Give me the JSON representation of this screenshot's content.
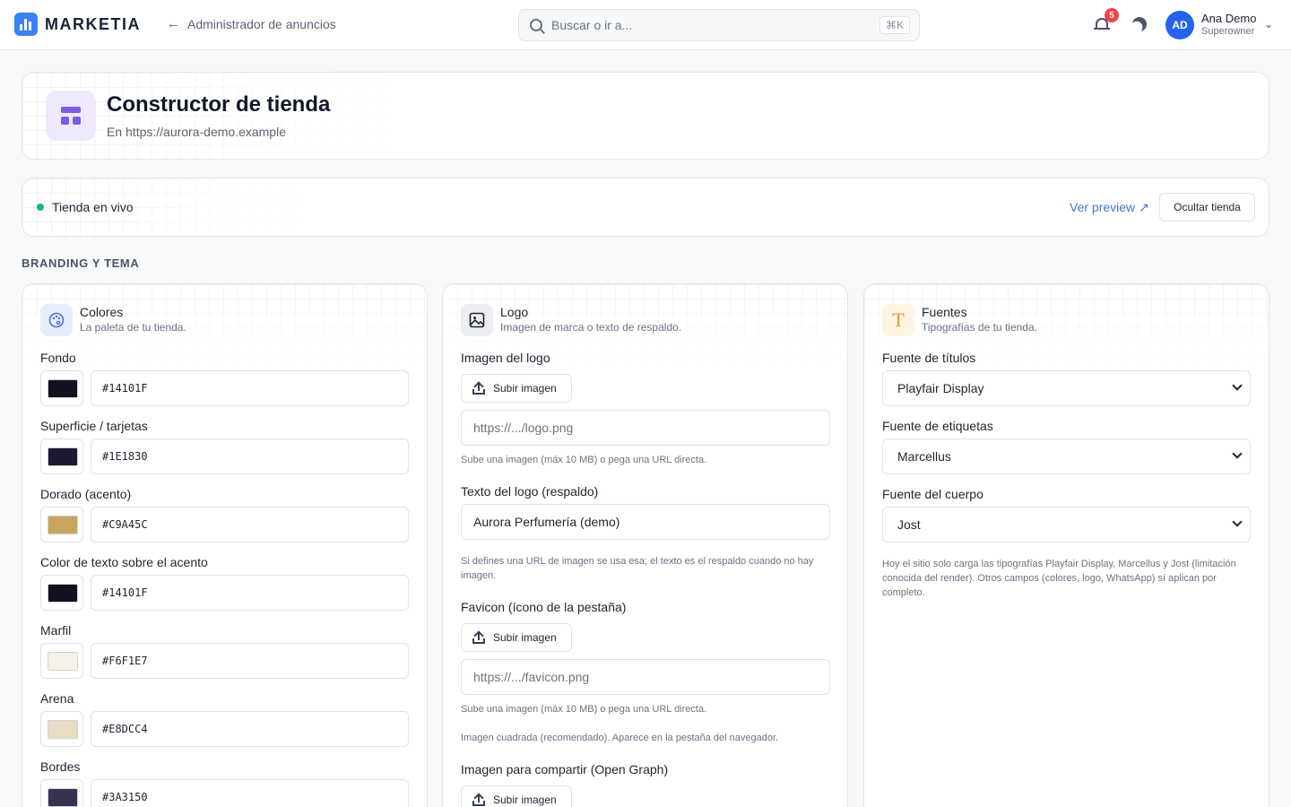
{
  "topbar": {
    "brand": "MARKETIA",
    "back_label": "Administrador de anuncios",
    "search_placeholder": "Buscar o ir a...",
    "search_shortcut": "⌘K",
    "notifications_count": "5",
    "user": {
      "initials": "AD",
      "name": "Ana Demo",
      "role": "Superowner"
    }
  },
  "header": {
    "title": "Constructor de tienda",
    "subtitle": "En https://aurora-demo.example"
  },
  "status": {
    "live_label": "Tienda en vivo",
    "preview_label": "Ver preview ↗",
    "hide_label": "Ocultar tienda"
  },
  "section_title": "BRANDING Y TEMA",
  "colors": {
    "title": "Colores",
    "description": "La paleta de tu tienda.",
    "fields": [
      {
        "label": "Fondo",
        "value": "#14101F",
        "swatch": "#14101F"
      },
      {
        "label": "Superficie / tarjetas",
        "value": "#1E1830",
        "swatch": "#1E1830"
      },
      {
        "label": "Dorado (acento)",
        "value": "#C9A45C",
        "swatch": "#C9A45C"
      },
      {
        "label": "Color de texto sobre el acento",
        "value": "#14101F",
        "swatch": "#14101F"
      },
      {
        "label": "Marfil",
        "value": "#F6F1E7",
        "swatch": "#F6F1E7"
      },
      {
        "label": "Arena",
        "value": "#E8DCC4",
        "swatch": "#E8DCC4"
      },
      {
        "label": "Bordes",
        "value": "#3A3150",
        "swatch": "#3A3150"
      }
    ]
  },
  "logo": {
    "title": "Logo",
    "description": "Imagen de marca o texto de respaldo.",
    "image_label": "Imagen del logo",
    "upload_label": "Subir imagen",
    "logo_url_placeholder": "https://.../logo.png",
    "upload_hint": "Sube una imagen (máx 10 MB) o pega una URL directa.",
    "text_label": "Texto del logo (respaldo)",
    "text_value": "Aurora Perfumería (demo)",
    "text_hint": "Si defines una URL de imagen se usa esa; el texto es el respaldo cuando no hay imagen.",
    "favicon_label": "Favicon (ícono de la pestaña)",
    "favicon_upload_label": "Subir imagen",
    "favicon_url_placeholder": "https://.../favicon.png",
    "favicon_upload_hint": "Sube una imagen (máx 10 MB) o pega una URL directa.",
    "favicon_hint": "Imagen cuadrada (recomendado). Aparece en la pestaña del navegador.",
    "og_label": "Imagen para compartir (Open Graph)",
    "og_upload_label": "Subir imagen"
  },
  "fonts": {
    "title": "Fuentes",
    "description": "Tipografías de tu tienda.",
    "titles_label": "Fuente de títulos",
    "titles_value": "Playfair Display",
    "labels_label": "Fuente de etiquetas",
    "labels_value": "Marcellus",
    "body_label": "Fuente del cuerpo",
    "body_value": "Jost",
    "note": "Hoy el sitio solo carga las tipografías Playfair Display, Marcellus y Jost (limitación conocida del render). Otros campos (colores, logo, WhatsApp) sí aplican por completo."
  },
  "accent_colors": {
    "brand": "#3B82F6",
    "live": "#10B981",
    "badge": "#EF4444",
    "store_icon": "#7C5CE6"
  }
}
